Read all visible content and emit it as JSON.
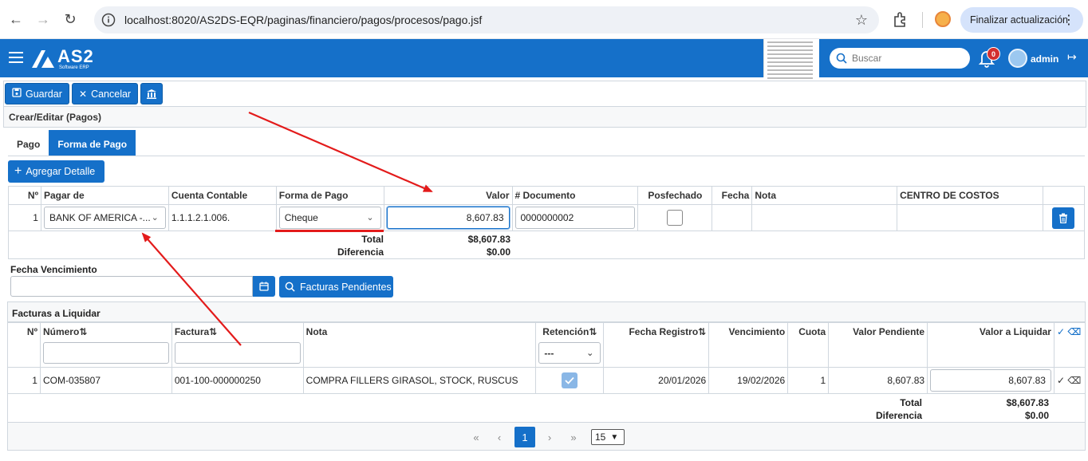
{
  "browser": {
    "url": "localhost:8020/AS2DS-EQR/paginas/financiero/pagos/procesos/pago.jsf",
    "update_label": "Finalizar actualización"
  },
  "app": {
    "logo_text": "AS2",
    "logo_sub": "Software ERP",
    "search_placeholder": "Buscar",
    "notifications": "0",
    "user": "admin"
  },
  "toolbar": {
    "save_label": "Guardar",
    "cancel_label": "Cancelar"
  },
  "panel_title": "Crear/Editar (Pagos)",
  "tabs": [
    {
      "label": "Pago",
      "active": false
    },
    {
      "label": "Forma de Pago",
      "active": true
    }
  ],
  "add_detail_label": "Agregar Detalle",
  "payment_table": {
    "headers": [
      "Nº",
      "Pagar de",
      "Cuenta Contable",
      "Forma de Pago",
      "Valor",
      "# Documento",
      "Posfechado",
      "Fecha",
      "Nota",
      "CENTRO DE COSTOS"
    ],
    "row": {
      "n": "1",
      "pagar_de": "BANK OF AMERICA -...",
      "cuenta": "1.1.1.2.1.006.",
      "forma": "Cheque",
      "valor": "8,607.83",
      "documento": "0000000002"
    },
    "total_label": "Total",
    "total_value": "$8,607.83",
    "diff_label": "Diferencia",
    "diff_value": "$0.00"
  },
  "due_date_label": "Fecha Vencimiento",
  "pending_btn_label": "Facturas Pendientes",
  "invoices": {
    "title": "Facturas a Liquidar",
    "headers": [
      "Nº",
      "Número",
      "Factura",
      "Nota",
      "Retención",
      "Fecha Registro",
      "Vencimiento",
      "Cuota",
      "Valor Pendiente",
      "Valor a Liquidar"
    ],
    "retencion_filter": "---",
    "rows": [
      {
        "n": "1",
        "numero": "COM-035807",
        "factura": "001-100-000000250",
        "nota": "COMPRA FILLERS GIRASOL, STOCK, RUSCUS",
        "fecha_registro": "20/01/2026",
        "vencimiento": "19/02/2026",
        "cuota": "1",
        "valor_pendiente": "8,607.83",
        "valor_liquidar": "8,607.83"
      }
    ],
    "total_label": "Total",
    "total_value": "$8,607.83",
    "diff_label": "Diferencia",
    "diff_value": "$0.00"
  },
  "pager": {
    "current_page": "1",
    "rows_per_page": "15"
  },
  "colors": {
    "primary": "#1570c9",
    "annotation": "#e31b1b"
  }
}
